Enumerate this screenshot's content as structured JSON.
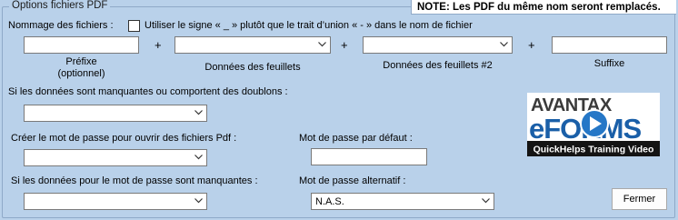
{
  "group": {
    "title": "Options fichiers PDF",
    "note": "NOTE: Les PDF du même nom seront remplacés."
  },
  "naming": {
    "label": "Nommage des fichiers :",
    "underscore_option": "Utiliser le signe « _ » plutôt que le trait d’union « - » dans le nom de fichier",
    "underscore_checked": false,
    "prefix_label": "Préfixe\n(optionnel)",
    "sheet_data_label": "Données des feuillets",
    "sheet_data2_label": "Données des feuillets #2",
    "suffix_label": "Suffixe",
    "plus": "+"
  },
  "missing_data": {
    "label": "Si les données sont manquantes ou comportent des doublons :"
  },
  "open_password": {
    "label": "Créer le mot de passe pour ouvrir des fichiers Pdf :"
  },
  "default_password": {
    "label": "Mot de passe par défaut :"
  },
  "missing_password": {
    "label": "Si les données pour le mot de passe sont manquantes :"
  },
  "alt_password": {
    "label": "Mot de passe alternatif :",
    "value": "N.A.S."
  },
  "logo": {
    "line1": "AVANTAX",
    "line2": "eFORMS",
    "tagline": "QuickHelps Training Video"
  },
  "close_button": "Fermer"
}
